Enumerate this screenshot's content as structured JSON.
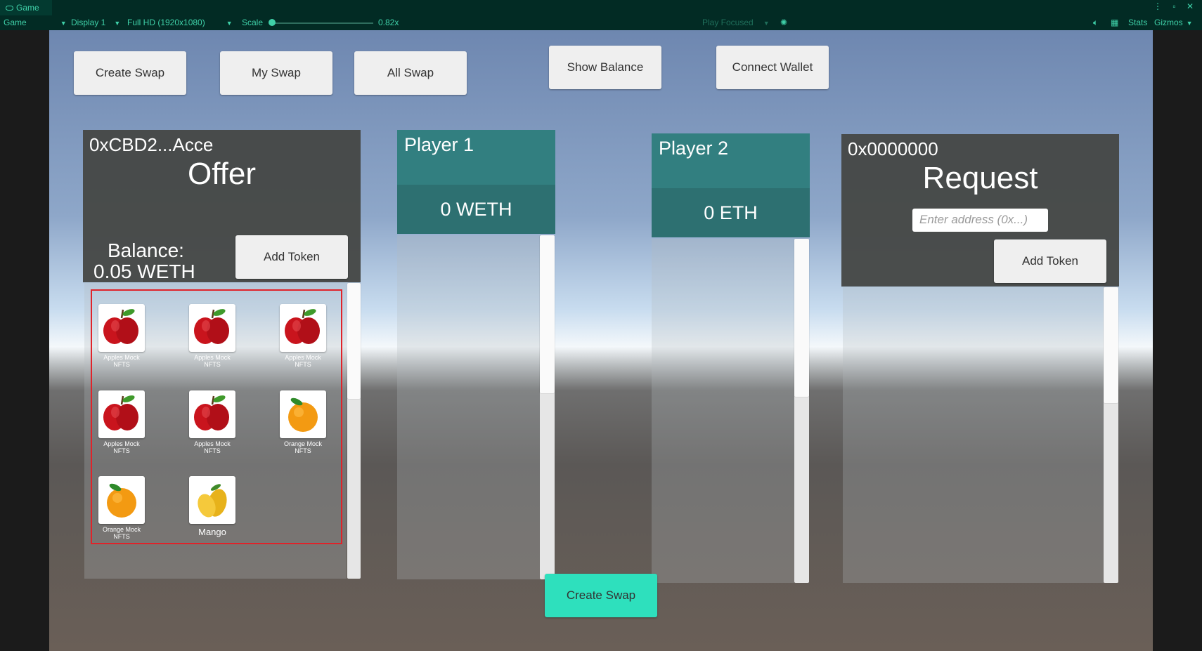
{
  "window": {
    "tab_label": "Game"
  },
  "toolbar": {
    "view": "Game",
    "display": "Display 1",
    "resolution": "Full HD (1920x1080)",
    "scale_label": "Scale",
    "scale_value": "0.82x",
    "play_mode": "Play Focused",
    "stats": "Stats",
    "gizmos": "Gizmos"
  },
  "nav": {
    "create_swap": "Create Swap",
    "my_swap": "My Swap",
    "all_swap": "All Swap",
    "show_balance": "Show Balance",
    "connect_wallet": "Connect Wallet"
  },
  "offer": {
    "address": "0xCBD2...Acce",
    "title": "Offer",
    "balance_label": "Balance:",
    "balance_value": "0.05 WETH",
    "add_token": "Add Token",
    "scroll_position": 0,
    "items": [
      {
        "label": "Apples Mock NFTS",
        "icon": "apple-icon"
      },
      {
        "label": "Apples Mock NFTS",
        "icon": "apple-icon"
      },
      {
        "label": "Apples Mock NFTS",
        "icon": "apple-icon"
      },
      {
        "label": "Apples Mock NFTS",
        "icon": "apple-icon"
      },
      {
        "label": "Apples Mock NFTS",
        "icon": "apple-icon"
      },
      {
        "label": "Orange Mock NFTS",
        "icon": "orange-icon"
      },
      {
        "label": "Orange Mock NFTS",
        "icon": "orange-icon"
      },
      {
        "label": "Mango",
        "icon": "mango-icon"
      }
    ]
  },
  "player1": {
    "name": "Player 1",
    "balance": "0 WETH"
  },
  "player2": {
    "name": "Player 2",
    "balance": "0 ETH"
  },
  "request": {
    "address": "0x0000000",
    "title": "Request",
    "address_placeholder": "Enter address (0x...)",
    "add_token": "Add Token"
  },
  "footer": {
    "create_swap": "Create Swap"
  },
  "colors": {
    "accent": "#3fd0a8",
    "primary_button": "#2ee0bd",
    "player_header": "#327f80",
    "selection_border": "#e0232a"
  }
}
